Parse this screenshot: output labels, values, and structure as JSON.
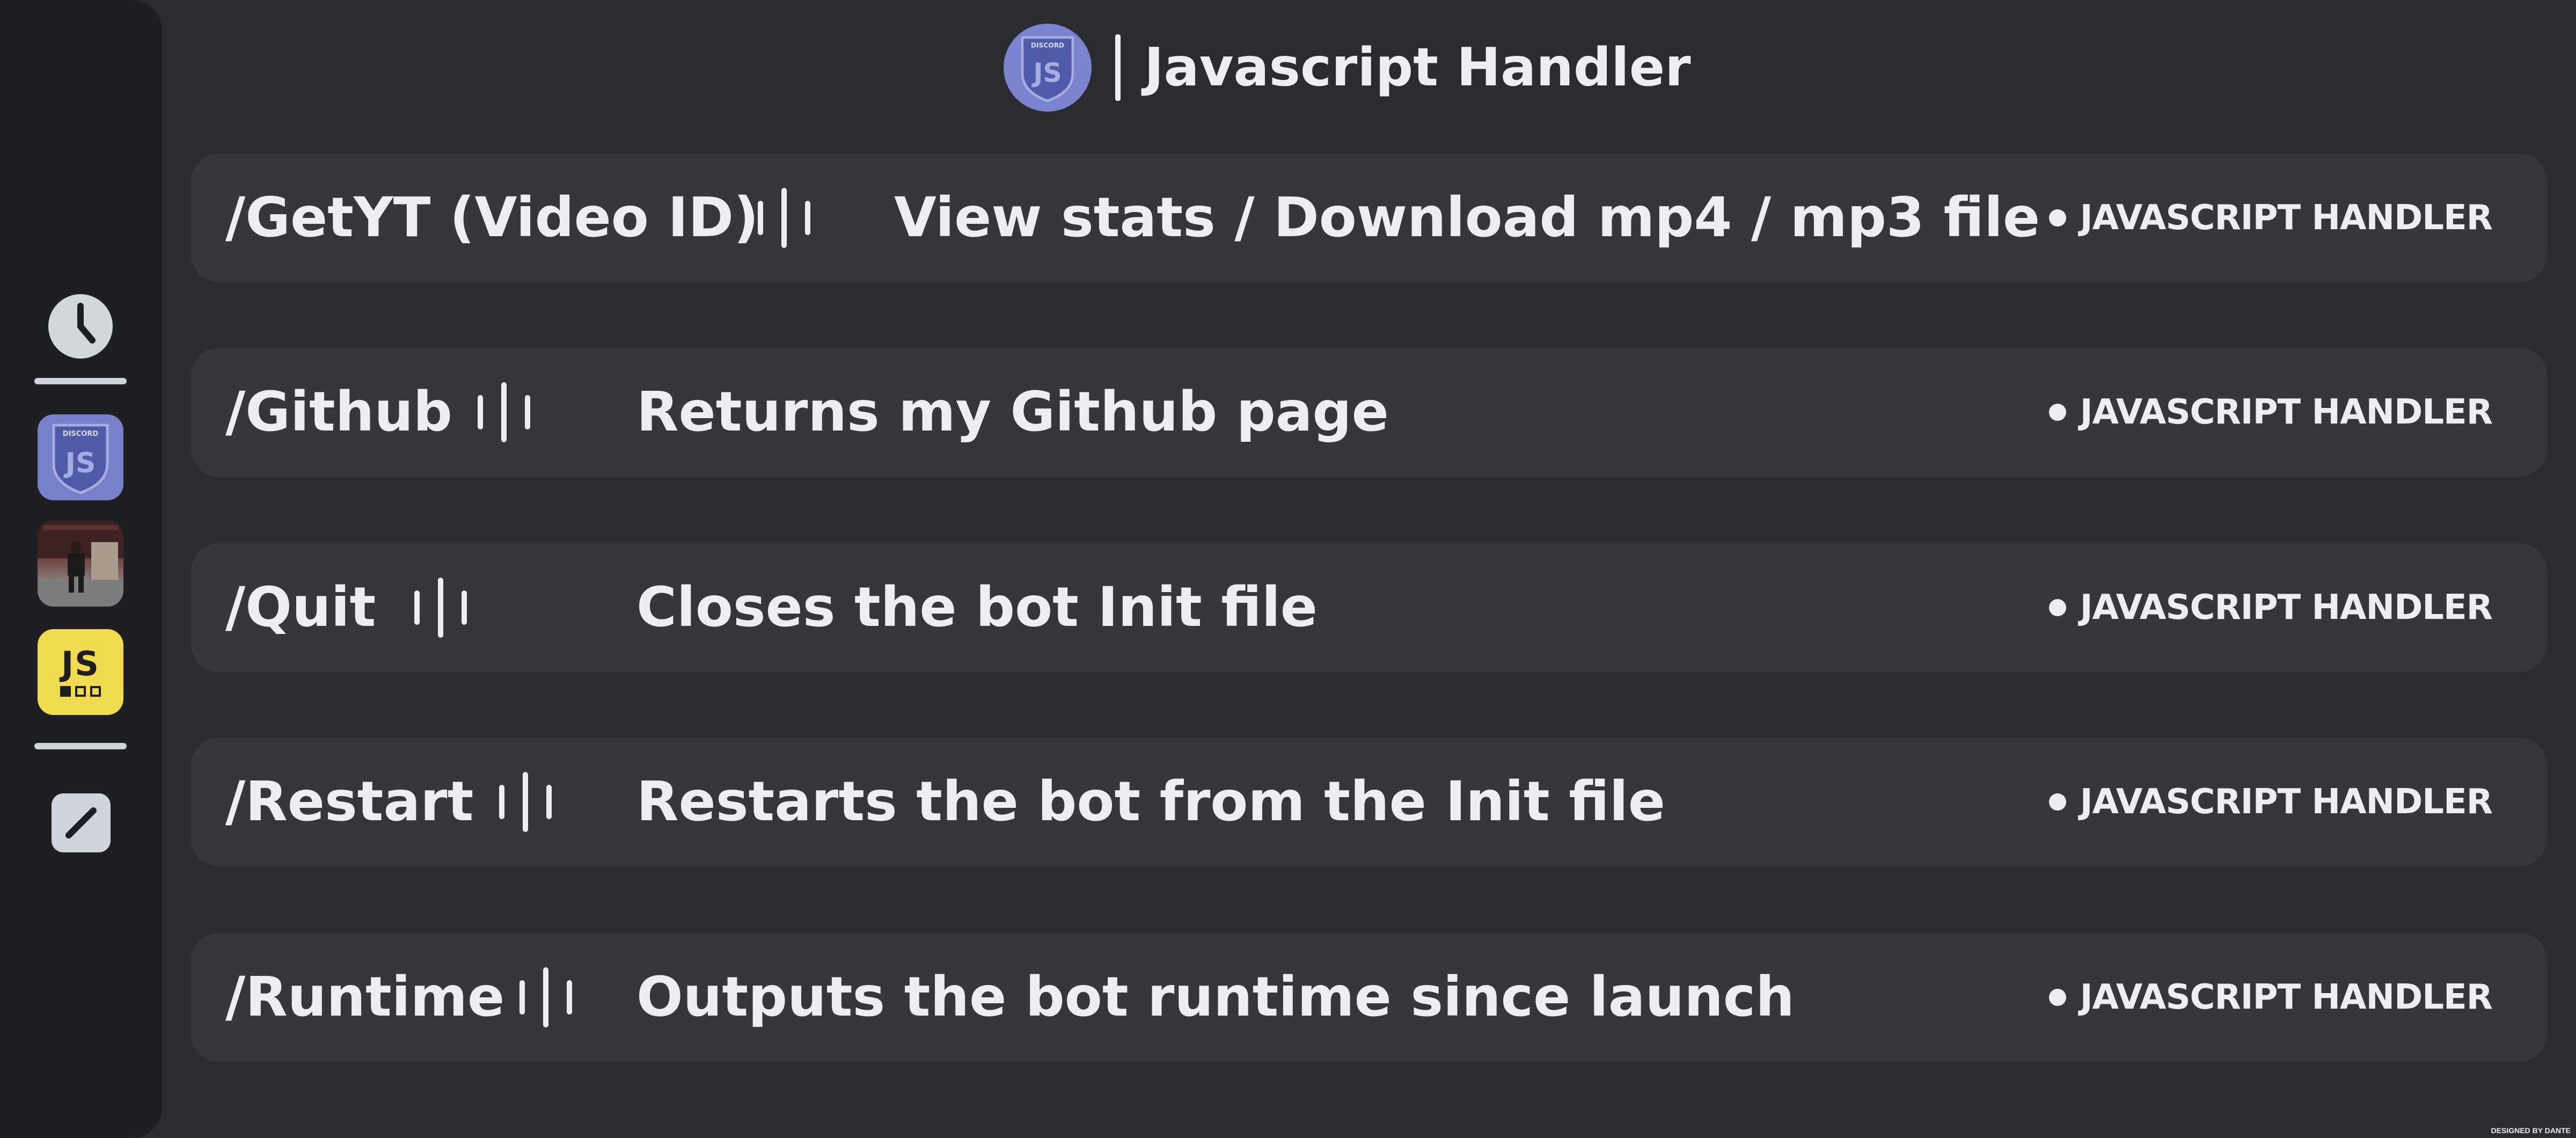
{
  "header": {
    "title": "Javascript Handler",
    "logo_icon": "discord-js-shield-icon",
    "logo_caption": "DISCORD",
    "logo_letters": "JS"
  },
  "sidebar": {
    "items": [
      {
        "icon": "clock-icon"
      },
      {
        "icon": "discord-js-shield-icon",
        "caption": "DISCORD",
        "letters": "JS"
      },
      {
        "icon": "user-photo-avatar"
      },
      {
        "icon": "javascript-logo-icon",
        "letters": "JS"
      },
      {
        "icon": "pencil-edit-icon"
      }
    ]
  },
  "commands": [
    {
      "name": "/GetYT (Video ID)",
      "description": "View stats / Download mp4 / mp3 file",
      "tag": "JAVASCRIPT HANDLER"
    },
    {
      "name": "/Github",
      "description": "Returns my Github page",
      "tag": "JAVASCRIPT HANDLER"
    },
    {
      "name": "/Quit",
      "description": "Closes the bot Init file",
      "tag": "JAVASCRIPT HANDLER"
    },
    {
      "name": "/Restart",
      "description": "Restarts the bot from the Init file",
      "tag": "JAVASCRIPT HANDLER"
    },
    {
      "name": "/Runtime",
      "description": "Outputs the bot runtime since launch",
      "tag": "JAVASCRIPT HANDLER"
    }
  ],
  "separator_icon": "bars-separator-icon",
  "footer": {
    "credit": "DESIGNED BY DANTE"
  },
  "colors": {
    "background": "#2b2c30",
    "sidebar": "#1e1f22",
    "row": "#36373c",
    "text": "#eceef1",
    "blurple": "#7b83cf",
    "js_yellow": "#f0db4f"
  }
}
